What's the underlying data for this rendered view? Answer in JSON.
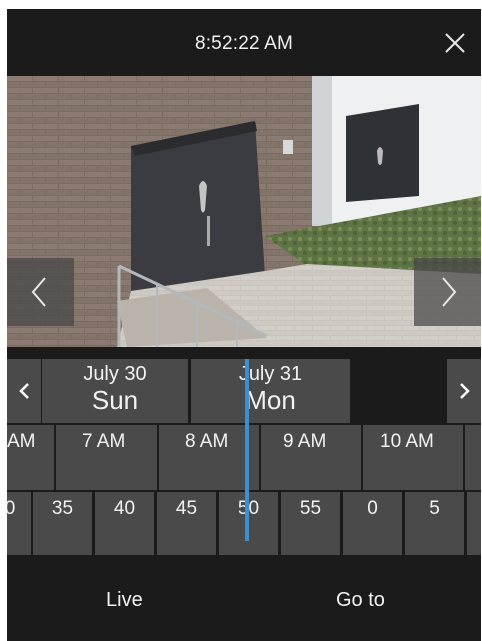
{
  "header": {
    "title": "8:52:22 AM",
    "close_icon": "close-icon"
  },
  "video": {
    "prev_icon": "chevron-left-icon",
    "next_icon": "chevron-right-icon"
  },
  "days": {
    "prev_icon": "chevron-left-icon",
    "next_icon": "chevron-right-icon",
    "items": [
      {
        "month": "July 30",
        "name": "Sun"
      },
      {
        "month": "July 31",
        "name": "Mon"
      }
    ]
  },
  "hours": [
    "AM",
    "7 AM",
    "8 AM",
    "9 AM",
    "10 AM"
  ],
  "minutes": [
    "0",
    "35",
    "40",
    "45",
    "50",
    "55",
    "0",
    "5"
  ],
  "playhead_color": "#3c8fd0",
  "bottom": {
    "live_label": "Live",
    "goto_label": "Go to"
  }
}
